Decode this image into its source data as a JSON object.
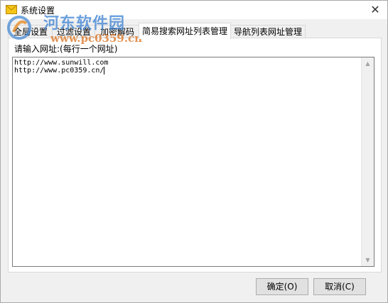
{
  "window": {
    "title": "系统设置",
    "close_glyph": "✕",
    "icon": "envelope-icon",
    "accent": "#f5c518"
  },
  "watermark": {
    "text": "河东软件园",
    "url": "www.pc0359.cn"
  },
  "tabs": [
    {
      "label": "全局设置",
      "active": false
    },
    {
      "label": "过滤设置",
      "active": false
    },
    {
      "label": "加密解码",
      "active": false
    },
    {
      "label": "简易搜索网址列表管理",
      "active": true
    },
    {
      "label": "导航列表网址管理",
      "active": false
    }
  ],
  "panel": {
    "prompt": "请输入网址:(每行一个网址)",
    "urls": [
      "http://www.sunwill.com",
      "http://www.pc0359.cn/"
    ]
  },
  "buttons": {
    "ok": "确定(O)",
    "cancel": "取消(C)"
  }
}
